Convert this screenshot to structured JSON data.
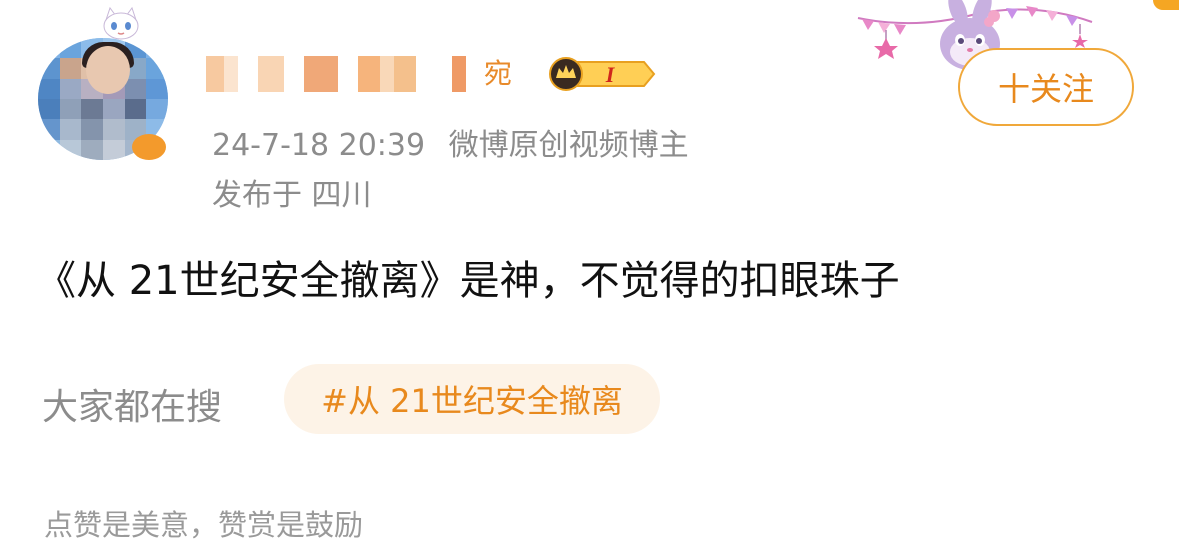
{
  "post": {
    "author": {
      "name_tail": "宛",
      "badge_label": "I"
    },
    "meta": {
      "timestamp": "24-7-18 20:39",
      "role": "微博原创视频博主",
      "location": "发布于 四川"
    },
    "follow_label": "十关注",
    "text": "《从 21世纪安全撤离》是神，不觉得的扣眼珠子"
  },
  "search": {
    "label": "大家都在搜",
    "hashtag": "#从 21世纪安全撤离"
  },
  "footer": {
    "text": "点赞是美意，赞赏是鼓励"
  },
  "colors": {
    "accent": "#e8891d",
    "chip_bg": "#fdf3e7",
    "muted": "#8c8c8c"
  }
}
